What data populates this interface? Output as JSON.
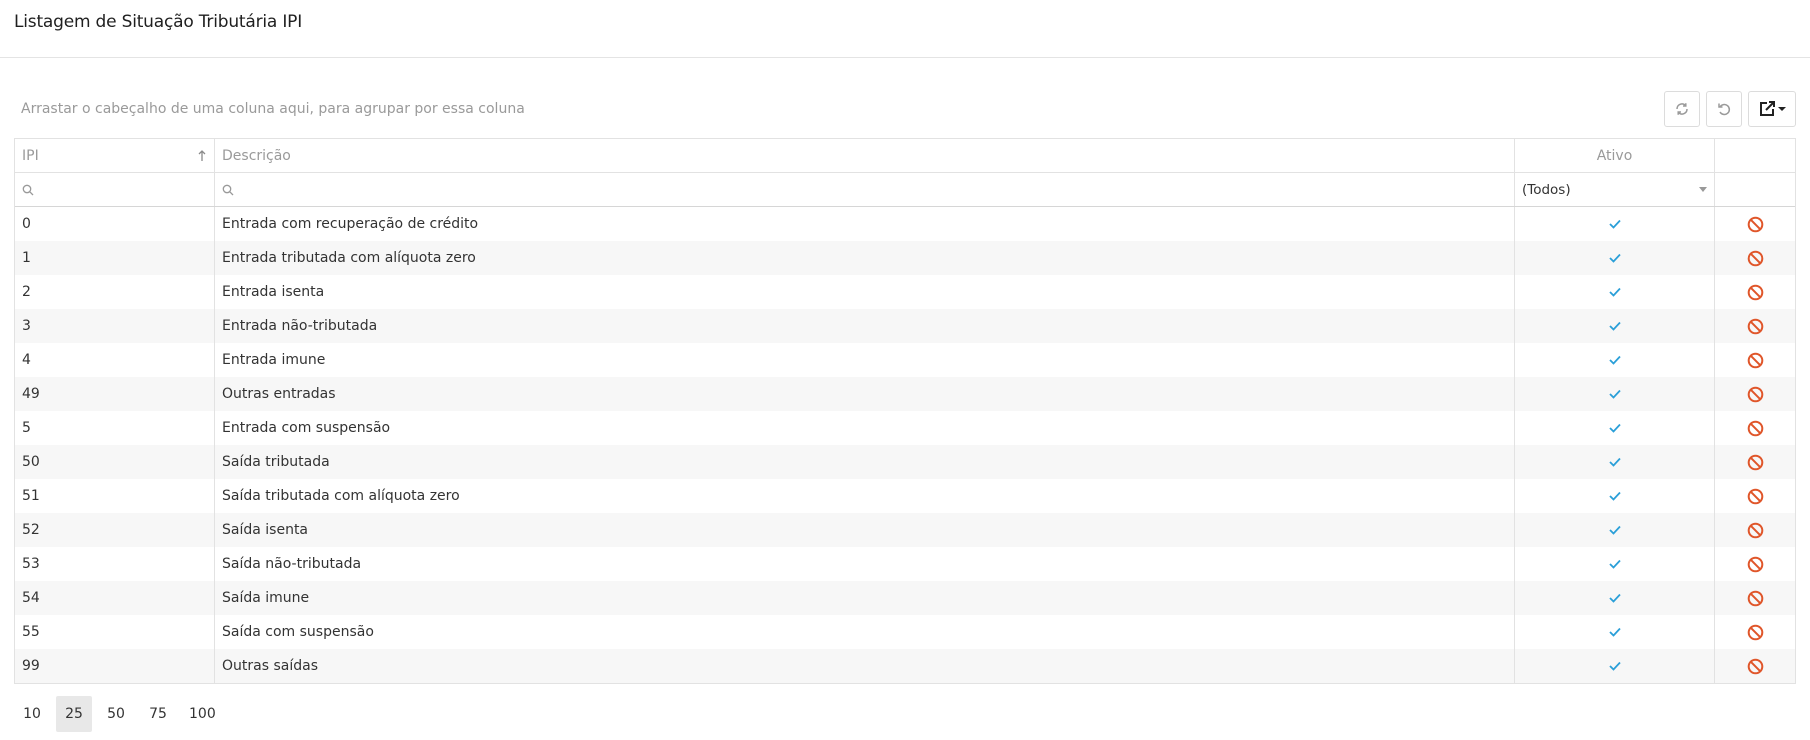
{
  "page": {
    "title": "Listagem de Situação Tributária IPI"
  },
  "toolbar": {
    "group_panel_text": "Arrastar o cabeçalho de uma coluna aqui, para agrupar por essa coluna",
    "buttons": [
      "refresh-icon",
      "undo-icon",
      "export-icon"
    ]
  },
  "columns": {
    "ipi": "IPI",
    "descricao": "Descrição",
    "ativo": "Ativo"
  },
  "filters": {
    "ativo_selected": "(Todos)"
  },
  "rows": [
    {
      "ipi": "0",
      "descricao": "Entrada com recuperação de crédito",
      "ativo": true
    },
    {
      "ipi": "1",
      "descricao": "Entrada tributada com alíquota zero",
      "ativo": true
    },
    {
      "ipi": "2",
      "descricao": "Entrada isenta",
      "ativo": true
    },
    {
      "ipi": "3",
      "descricao": "Entrada não-tributada",
      "ativo": true
    },
    {
      "ipi": "4",
      "descricao": "Entrada imune",
      "ativo": true
    },
    {
      "ipi": "49",
      "descricao": "Outras entradas",
      "ativo": true
    },
    {
      "ipi": "5",
      "descricao": "Entrada com suspensão",
      "ativo": true
    },
    {
      "ipi": "50",
      "descricao": "Saída tributada",
      "ativo": true
    },
    {
      "ipi": "51",
      "descricao": "Saída tributada com alíquota zero",
      "ativo": true
    },
    {
      "ipi": "52",
      "descricao": "Saída isenta",
      "ativo": true
    },
    {
      "ipi": "53",
      "descricao": "Saída não-tributada",
      "ativo": true
    },
    {
      "ipi": "54",
      "descricao": "Saída imune",
      "ativo": true
    },
    {
      "ipi": "55",
      "descricao": "Saída com suspensão",
      "ativo": true
    },
    {
      "ipi": "99",
      "descricao": "Outras saídas",
      "ativo": true
    }
  ],
  "pager": {
    "sizes": [
      "10",
      "25",
      "50",
      "75",
      "100"
    ],
    "selected": "25"
  },
  "colors": {
    "check": "#2a9fd8",
    "disable": "#e0562a"
  }
}
